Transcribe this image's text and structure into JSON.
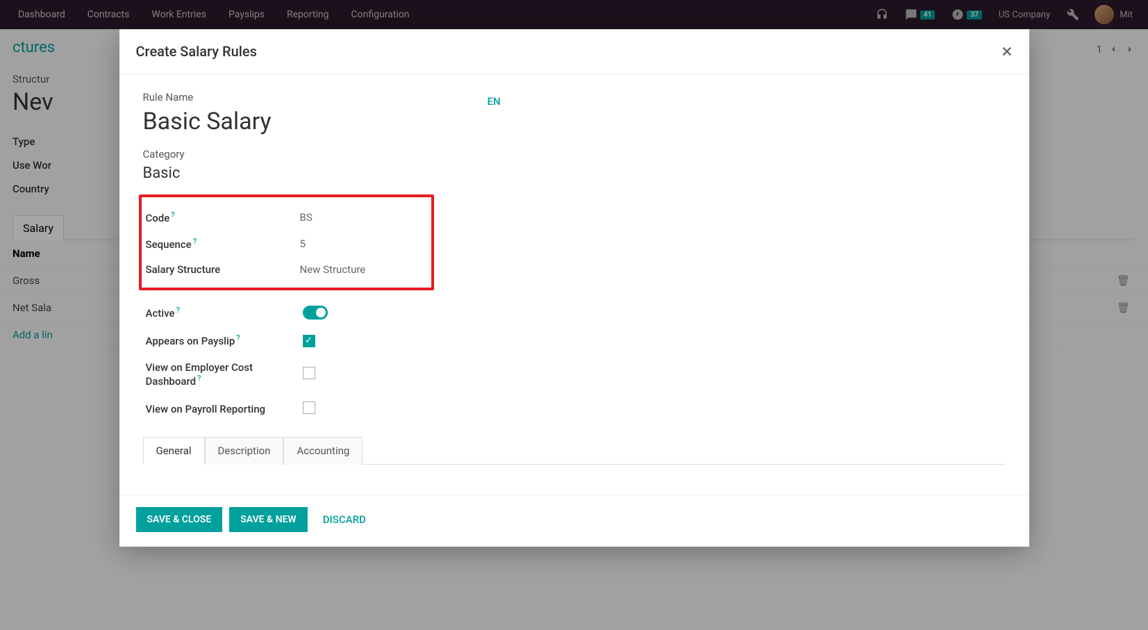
{
  "topbar": {
    "nav": [
      "Dashboard",
      "Contracts",
      "Work Entries",
      "Payslips",
      "Reporting",
      "Configuration"
    ],
    "messages_count": "41",
    "activities_count": "37",
    "company": "US Company",
    "user": "Mit"
  },
  "background": {
    "breadcrumb": "ctures",
    "structure_label": "Structur",
    "title": "Nev",
    "fields": {
      "type_label": "Type",
      "use_work_label": "Use Wor",
      "country_label": "Country"
    },
    "tab_label": "Salary",
    "table": {
      "header": "Name",
      "rows": [
        "Gross",
        "Net Sala"
      ],
      "add_line": "Add a lin"
    },
    "pager": "1"
  },
  "modal": {
    "title": "Create Salary Rules",
    "rule_name_label": "Rule Name",
    "rule_name_value": "Basic Salary",
    "lang_badge": "EN",
    "category_label": "Category",
    "category_value": "Basic",
    "boxed_fields": {
      "code_label": "Code",
      "code_value": "BS",
      "sequence_label": "Sequence",
      "sequence_value": "5",
      "salary_structure_label": "Salary Structure",
      "salary_structure_value": "New Structure"
    },
    "plain_fields": {
      "active_label": "Active",
      "appears_label": "Appears on Payslip",
      "employer_cost_label": "View on Employer Cost Dashboard",
      "payroll_reporting_label": "View on Payroll Reporting"
    },
    "tabs": [
      "General",
      "Description",
      "Accounting"
    ],
    "footer": {
      "save_close": "SAVE & CLOSE",
      "save_new": "SAVE & NEW",
      "discard": "DISCARD"
    }
  }
}
